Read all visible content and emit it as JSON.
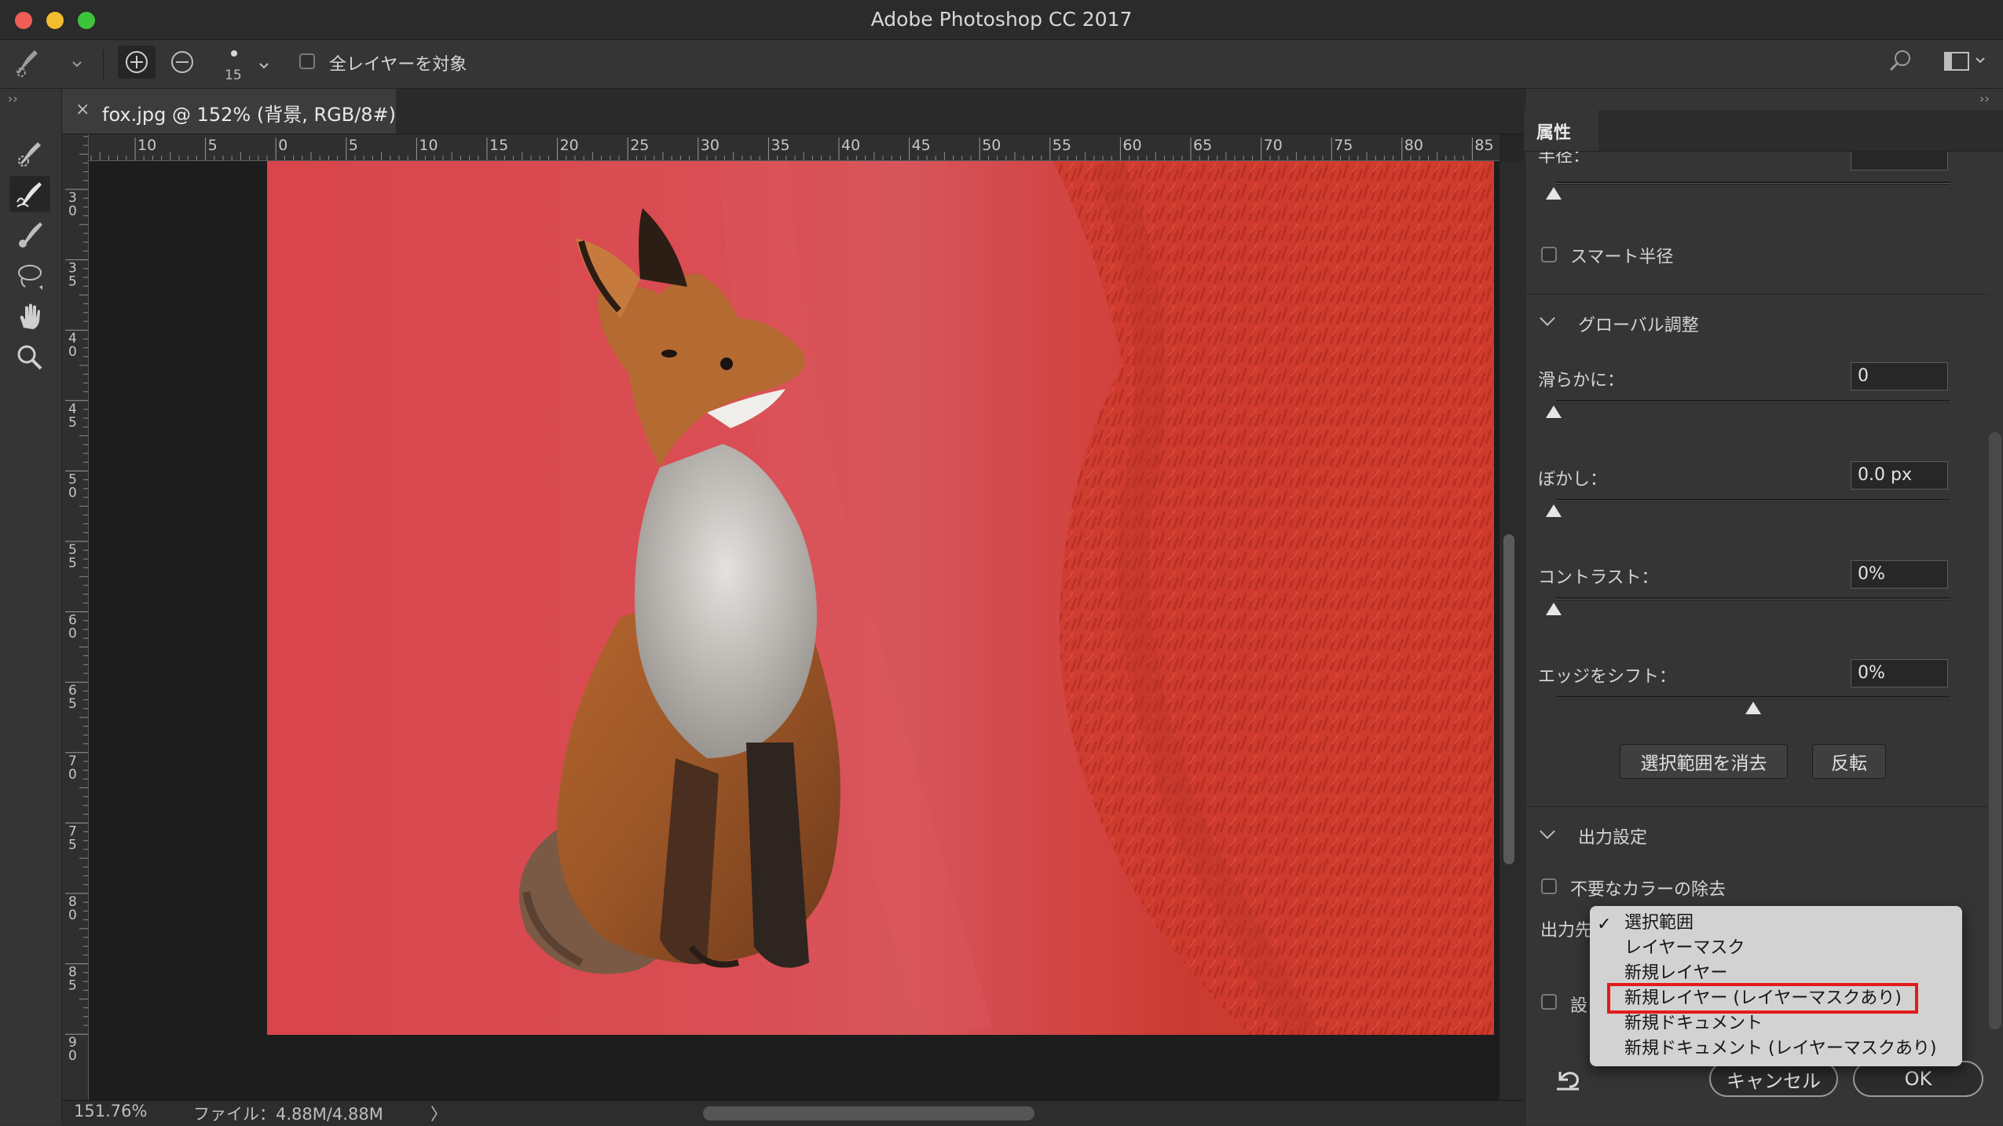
{
  "window": {
    "title": "Adobe Photoshop CC 2017",
    "traffic_colors": [
      "#ee5e57",
      "#f4bd30",
      "#3ec43c"
    ]
  },
  "options_bar": {
    "brush_size": "15",
    "sample_all_layers_label": "全レイヤーを対象"
  },
  "toolbar": {
    "tools": [
      "quick-selection-tool",
      "refine-edge-brush-tool",
      "brush-tool",
      "lasso-tool",
      "hand-tool",
      "zoom-tool"
    ],
    "active_tool": "refine-edge-brush-tool"
  },
  "document": {
    "tab_title": "fox.jpg @ 152% (背景, RGB/8#)",
    "close_label": "×",
    "h_ruler_labels": [
      "10",
      "5",
      "0",
      "5",
      "10",
      "15",
      "20",
      "25",
      "30",
      "35",
      "40",
      "45",
      "50",
      "55",
      "60",
      "65",
      "70",
      "75",
      "80",
      "85"
    ],
    "v_ruler_labels": [
      "30",
      "35",
      "40",
      "45",
      "50",
      "55",
      "60",
      "65",
      "70",
      "75",
      "80",
      "85",
      "90"
    ],
    "overlay_color": "#d9464d"
  },
  "statusbar": {
    "zoom": "151.76%",
    "file_info": "ファイル：4.88M/4.88M",
    "arrow": "〉"
  },
  "properties": {
    "panel_tab": "属性",
    "radius_label": "半径：",
    "smart_radius_label": "スマート半径",
    "global_section": "グローバル調整",
    "smooth_label": "滑らかに：",
    "smooth_value": "0",
    "feather_label": "ぼかし：",
    "feather_value": "0.0 px",
    "contrast_label": "コントラスト：",
    "contrast_value": "0%",
    "shift_edge_label": "エッジをシフト：",
    "shift_edge_value": "0%",
    "clear_selection_button": "選択範囲を消去",
    "invert_button": "反転",
    "output_section": "出力設定",
    "decontaminate_label": "不要なカラーの除去",
    "output_to_label": "出力先",
    "remember_label": "設",
    "cancel_button": "キャンセル",
    "ok_button": "OK"
  },
  "dropdown": {
    "check": "✓",
    "options": [
      "選択範囲",
      "レイヤーマスク",
      "新規レイヤー",
      "新規レイヤー (レイヤーマスクあり)",
      "新規ドキュメント",
      "新規ドキュメント (レイヤーマスクあり)"
    ],
    "selected": "選択範囲",
    "highlighted": "新規レイヤー (レイヤーマスクあり)",
    "highlight_color": "#e31b1b"
  }
}
